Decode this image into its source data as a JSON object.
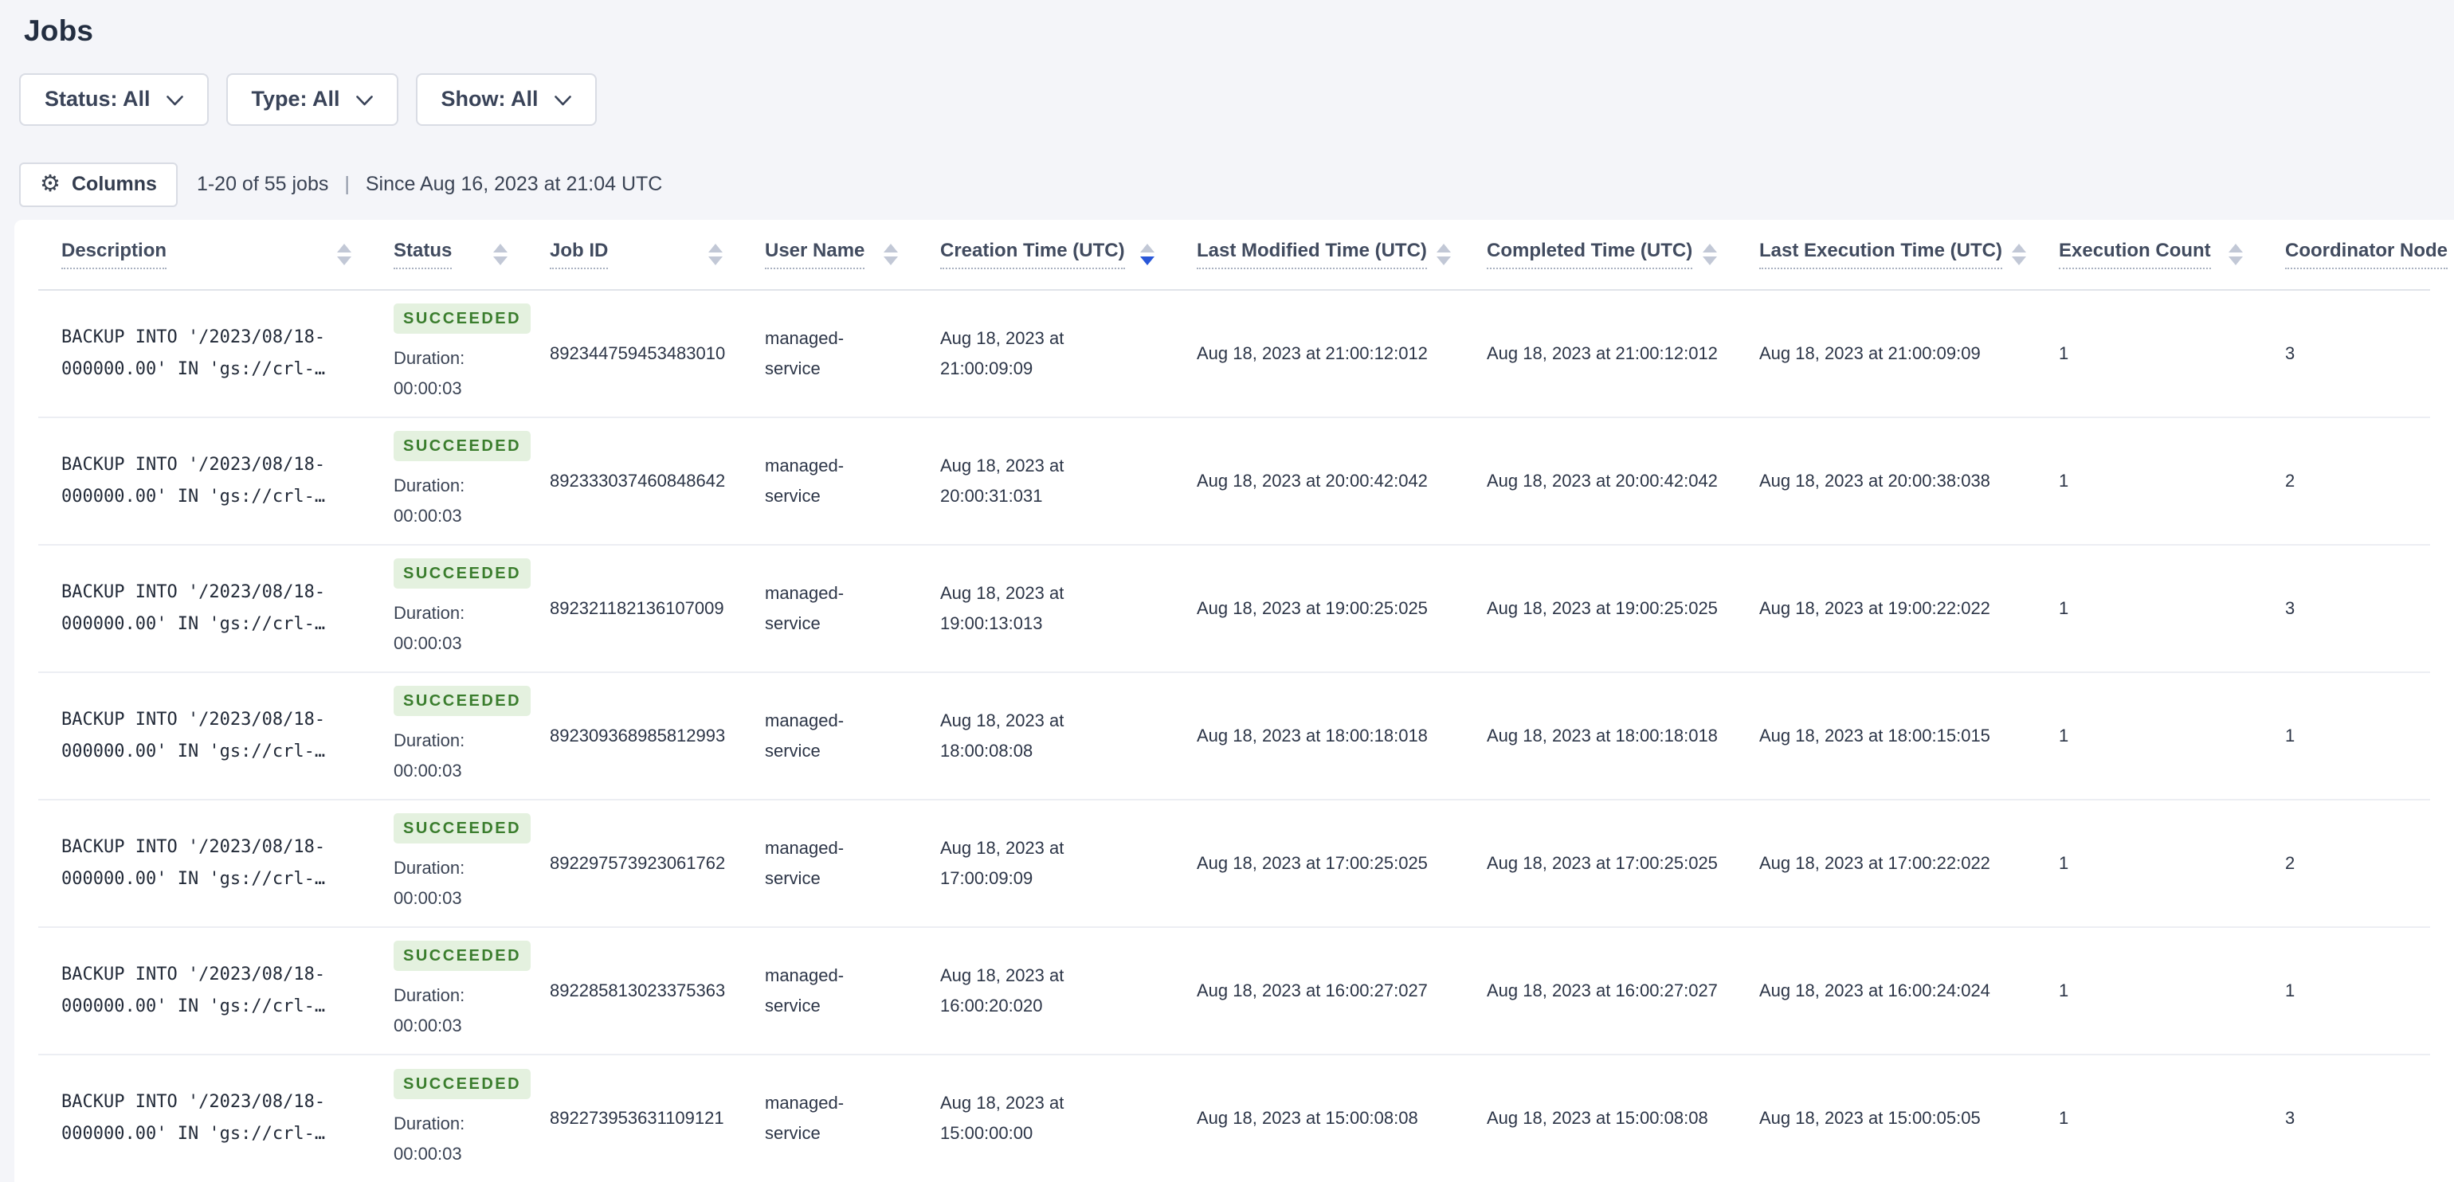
{
  "page": {
    "title": "Jobs"
  },
  "filters": [
    {
      "id": "status",
      "label": "Status: All"
    },
    {
      "id": "type",
      "label": "Type: All"
    },
    {
      "id": "show",
      "label": "Show: All"
    }
  ],
  "toolbar": {
    "columns_label": "Columns",
    "count_text": "1-20 of 55 jobs",
    "separator": "|",
    "since_text": "Since Aug 16, 2023 at 21:04 UTC"
  },
  "table": {
    "columns": [
      {
        "id": "description",
        "label": "Description",
        "sort": "none"
      },
      {
        "id": "status",
        "label": "Status",
        "sort": "none"
      },
      {
        "id": "job-id",
        "label": "Job ID",
        "sort": "none"
      },
      {
        "id": "user-name",
        "label": "User Name",
        "sort": "none"
      },
      {
        "id": "creation-time",
        "label": "Creation Time (UTC)",
        "sort": "desc"
      },
      {
        "id": "last-modified-time",
        "label": "Last Modified Time (UTC)",
        "sort": "none"
      },
      {
        "id": "completed-time",
        "label": "Completed Time (UTC)",
        "sort": "none"
      },
      {
        "id": "last-execution-time",
        "label": "Last Execution Time (UTC)",
        "sort": "none"
      },
      {
        "id": "execution-count",
        "label": "Execution Count",
        "sort": "none"
      },
      {
        "id": "coordinator-node",
        "label": "Coordinator Node",
        "sort": "none"
      }
    ],
    "rows": [
      {
        "description_lines": [
          "BACKUP INTO '/2023/08/18-",
          "000000.00' IN 'gs://crl-…"
        ],
        "status": "SUCCEEDED",
        "duration": "Duration: 00:00:03",
        "job_id": "892344759453483010",
        "user_name": "managed-service",
        "creation_time": "Aug 18, 2023 at 21:00:09:09",
        "last_modified_time": "Aug 18, 2023 at 21:00:12:012",
        "completed_time": "Aug 18, 2023 at 21:00:12:012",
        "last_execution_time": "Aug 18, 2023 at 21:00:09:09",
        "execution_count": "1",
        "coordinator_node": "3"
      },
      {
        "description_lines": [
          "BACKUP INTO '/2023/08/18-",
          "000000.00' IN 'gs://crl-…"
        ],
        "status": "SUCCEEDED",
        "duration": "Duration: 00:00:03",
        "job_id": "892333037460848642",
        "user_name": "managed-service",
        "creation_time": "Aug 18, 2023 at 20:00:31:031",
        "last_modified_time": "Aug 18, 2023 at 20:00:42:042",
        "completed_time": "Aug 18, 2023 at 20:00:42:042",
        "last_execution_time": "Aug 18, 2023 at 20:00:38:038",
        "execution_count": "1",
        "coordinator_node": "2"
      },
      {
        "description_lines": [
          "BACKUP INTO '/2023/08/18-",
          "000000.00' IN 'gs://crl-…"
        ],
        "status": "SUCCEEDED",
        "duration": "Duration: 00:00:03",
        "job_id": "892321182136107009",
        "user_name": "managed-service",
        "creation_time": "Aug 18, 2023 at 19:00:13:013",
        "last_modified_time": "Aug 18, 2023 at 19:00:25:025",
        "completed_time": "Aug 18, 2023 at 19:00:25:025",
        "last_execution_time": "Aug 18, 2023 at 19:00:22:022",
        "execution_count": "1",
        "coordinator_node": "3"
      },
      {
        "description_lines": [
          "BACKUP INTO '/2023/08/18-",
          "000000.00' IN 'gs://crl-…"
        ],
        "status": "SUCCEEDED",
        "duration": "Duration: 00:00:03",
        "job_id": "892309368985812993",
        "user_name": "managed-service",
        "creation_time": "Aug 18, 2023 at 18:00:08:08",
        "last_modified_time": "Aug 18, 2023 at 18:00:18:018",
        "completed_time": "Aug 18, 2023 at 18:00:18:018",
        "last_execution_time": "Aug 18, 2023 at 18:00:15:015",
        "execution_count": "1",
        "coordinator_node": "1"
      },
      {
        "description_lines": [
          "BACKUP INTO '/2023/08/18-",
          "000000.00' IN 'gs://crl-…"
        ],
        "status": "SUCCEEDED",
        "duration": "Duration: 00:00:03",
        "job_id": "892297573923061762",
        "user_name": "managed-service",
        "creation_time": "Aug 18, 2023 at 17:00:09:09",
        "last_modified_time": "Aug 18, 2023 at 17:00:25:025",
        "completed_time": "Aug 18, 2023 at 17:00:25:025",
        "last_execution_time": "Aug 18, 2023 at 17:00:22:022",
        "execution_count": "1",
        "coordinator_node": "2"
      },
      {
        "description_lines": [
          "BACKUP INTO '/2023/08/18-",
          "000000.00' IN 'gs://crl-…"
        ],
        "status": "SUCCEEDED",
        "duration": "Duration: 00:00:03",
        "job_id": "892285813023375363",
        "user_name": "managed-service",
        "creation_time": "Aug 18, 2023 at 16:00:20:020",
        "last_modified_time": "Aug 18, 2023 at 16:00:27:027",
        "completed_time": "Aug 18, 2023 at 16:00:27:027",
        "last_execution_time": "Aug 18, 2023 at 16:00:24:024",
        "execution_count": "1",
        "coordinator_node": "1"
      },
      {
        "description_lines": [
          "BACKUP INTO '/2023/08/18-",
          "000000.00' IN 'gs://crl-…"
        ],
        "status": "SUCCEEDED",
        "duration": "Duration: 00:00:03",
        "job_id": "892273953631109121",
        "user_name": "managed-service",
        "creation_time": "Aug 18, 2023 at 15:00:00:00",
        "last_modified_time": "Aug 18, 2023 at 15:00:08:08",
        "completed_time": "Aug 18, 2023 at 15:00:08:08",
        "last_execution_time": "Aug 18, 2023 at 15:00:05:05",
        "execution_count": "1",
        "coordinator_node": "3"
      }
    ]
  },
  "colors": {
    "page_background": "#f4f5f9",
    "card_background": "#ffffff",
    "succeeded_badge_background": "#e4f1df",
    "succeeded_badge_text": "#3a7d2d",
    "active_sort_arrow": "#2957d8",
    "inactive_sort_arrow": "#c2c8d6",
    "header_text": "#414b5f",
    "body_text": "#2c3547"
  }
}
